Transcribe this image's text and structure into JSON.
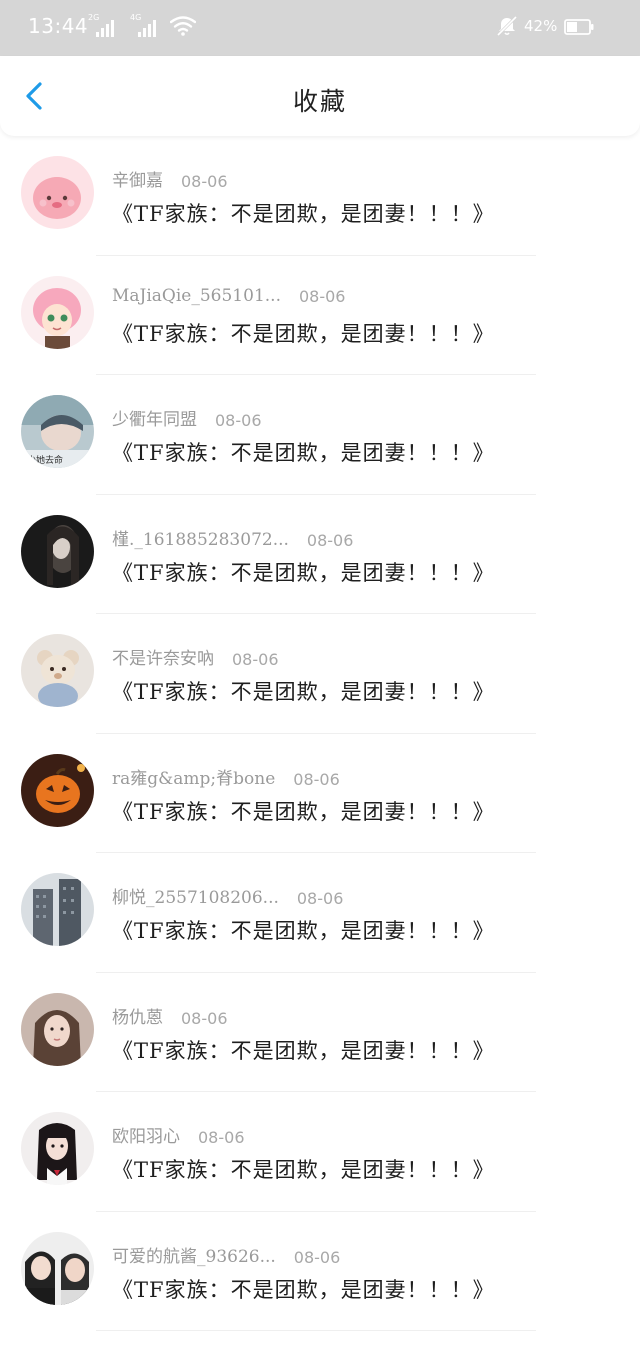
{
  "status_bar": {
    "time": "13:44",
    "signal1_tag": "2G",
    "signal2_tag": "4G",
    "battery": "42%"
  },
  "header": {
    "title": "收藏",
    "back_icon": "chevron-left-icon"
  },
  "colors": {
    "accent": "#1e9be8",
    "status_bar_bg": "#d6d6d6",
    "meta_text": "#9a9a9a",
    "title_text": "#1f1f1f"
  },
  "favorites": [
    {
      "author": "辛御嘉",
      "date": "08-06",
      "title": "《TF家族：不是团欺，是团妻！！！》"
    },
    {
      "author": "MaJiaQie_565101...",
      "date": "08-06",
      "title": "《TF家族：不是团欺，是团妻！！！》"
    },
    {
      "author": "少衢年同盟",
      "date": "08-06",
      "title": "《TF家族：不是团欺，是团妻！！！》"
    },
    {
      "author": "槿._161885283072...",
      "date": "08-06",
      "title": "《TF家族：不是团欺，是团妻！！！》"
    },
    {
      "author": "不是许奈安吶",
      "date": "08-06",
      "title": "《TF家族：不是团欺，是团妻！！！》"
    },
    {
      "author": "ra雍g&amp;脊bone",
      "date": "08-06",
      "title": "《TF家族：不是团欺，是团妻！！！》"
    },
    {
      "author": "柳悦_2557108206...",
      "date": "08-06",
      "title": "《TF家族：不是团欺，是团妻！！！》"
    },
    {
      "author": "杨仇蒽",
      "date": "08-06",
      "title": "《TF家族：不是团欺，是团妻！！！》"
    },
    {
      "author": "欧阳羽心",
      "date": "08-06",
      "title": "《TF家族：不是团欺，是团妻！！！》"
    },
    {
      "author": "可爱的航酱_93626...",
      "date": "08-06",
      "title": "《TF家族：不是团欺，是团妻！！！》"
    }
  ]
}
